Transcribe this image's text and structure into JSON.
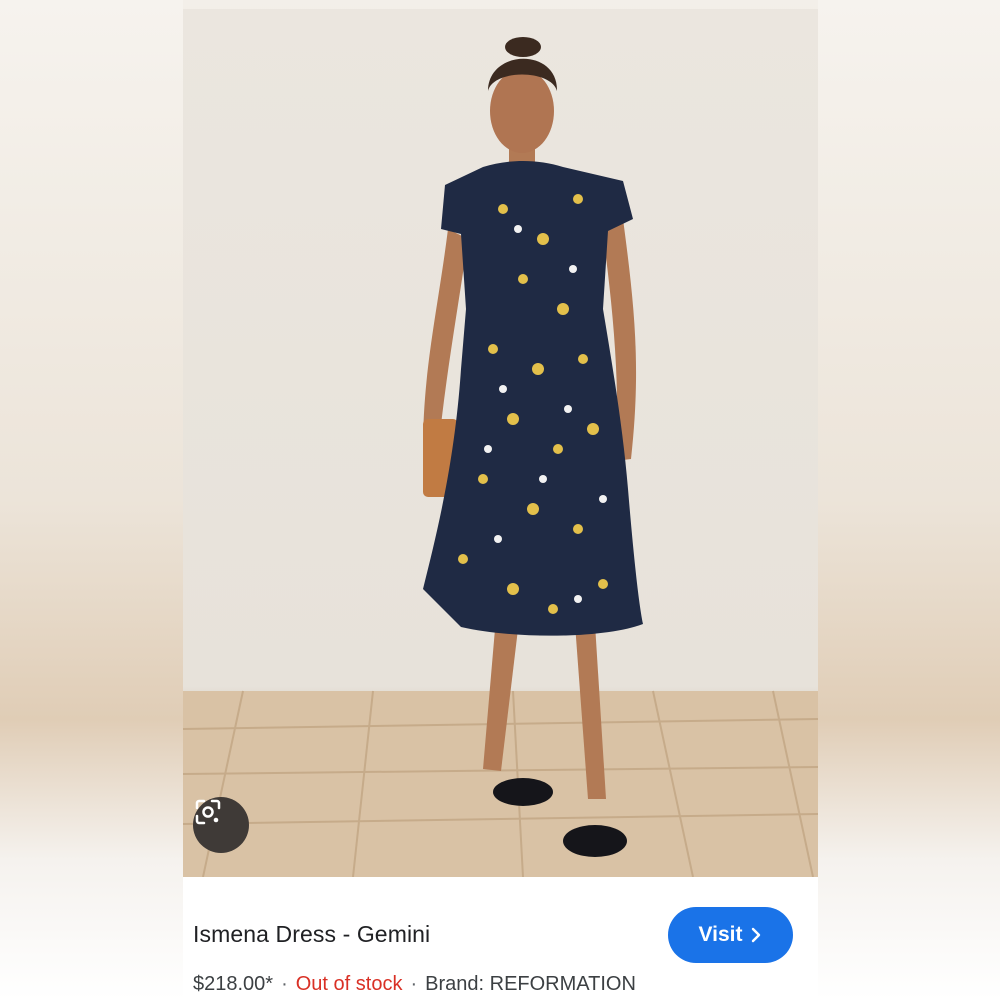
{
  "product": {
    "title": "Ismena Dress - Gemini",
    "price": "$218.00*",
    "separator": "·",
    "stock_status": "Out of stock",
    "brand": "Brand: REFORMATION"
  },
  "actions": {
    "visit_label": "Visit",
    "visit_icon": "chevron-right-icon",
    "lens_icon": "lens-search-icon"
  },
  "colors": {
    "visit_button": "#1a73e8",
    "out_of_stock": "#d93025",
    "dress": "#1f2a44",
    "floral": "#e3c04b"
  }
}
